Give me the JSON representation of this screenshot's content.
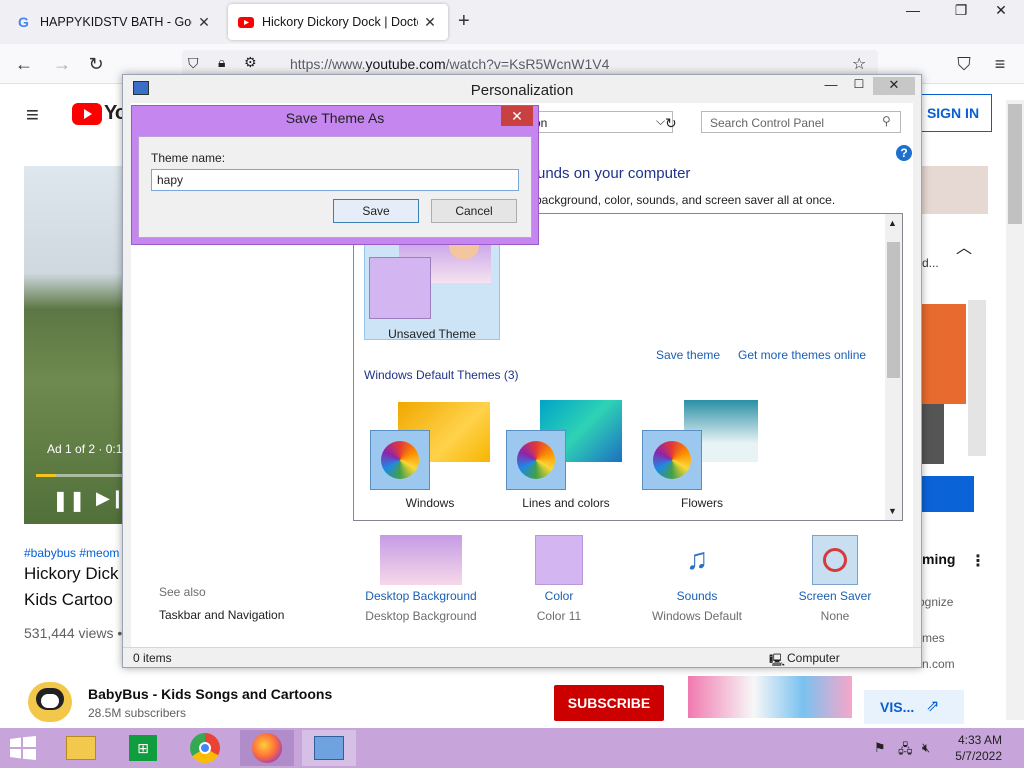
{
  "browser": {
    "tabs": [
      {
        "title": "HAPPYKIDSTV BATH - Google S",
        "favicon": "google-g-icon"
      },
      {
        "title": "Hickory Dickory Dock | Doctor",
        "favicon": "youtube-icon",
        "active": true
      }
    ],
    "url_prefix": "https://www.",
    "url_domain": "youtube.com",
    "url_path": "/watch?v=KsR5WcnW1V4"
  },
  "youtube": {
    "logo_text": "Yo",
    "signin": "SIGN IN",
    "ad_text": "Ad 1 of 2 · 0:1",
    "hashtags": "#babybus #meom",
    "video_title_1": "Hickory Dick",
    "video_title_2": "Kids Cartoo",
    "views": "531,444 views •",
    "channel_name": "BabyBus - Kids Songs and Cartoons",
    "subscribers": "28.5M subscribers",
    "subscribe": "SUBSCRIBE",
    "visit": "VIS...",
    "side_text_1": "d...",
    "side_ming": "ming",
    "side_ognize": "ognize",
    "side_mes": "mes",
    "side_com": "n.com"
  },
  "personalization": {
    "title": "Personalization",
    "address_text": "on",
    "search_placeholder": "Search Control Panel",
    "heading": "unds on your computer",
    "subheading": "p background, color, sounds, and screen saver all at once.",
    "unsaved_theme": "Unsaved Theme",
    "save_theme": "Save theme",
    "get_more": "Get more themes online",
    "default_themes_header": "Windows Default Themes (3)",
    "default_themes": [
      "Windows",
      "Lines and colors",
      "Flowers"
    ],
    "see_also": "See also",
    "taskbar_nav": "Taskbar and Navigation",
    "bottom": [
      {
        "link": "Desktop Background",
        "sub": "Desktop Background"
      },
      {
        "link": "Color",
        "sub": "Color 11"
      },
      {
        "link": "Sounds",
        "sub": "Windows Default"
      },
      {
        "link": "Screen Saver",
        "sub": "None"
      }
    ],
    "status_items": "0 items",
    "status_computer": "Computer"
  },
  "dialog": {
    "title": "Save Theme As",
    "label": "Theme name:",
    "value": "hapy",
    "save": "Save",
    "cancel": "Cancel"
  },
  "taskbar": {
    "time": "4:33 AM",
    "date": "5/7/2022"
  }
}
